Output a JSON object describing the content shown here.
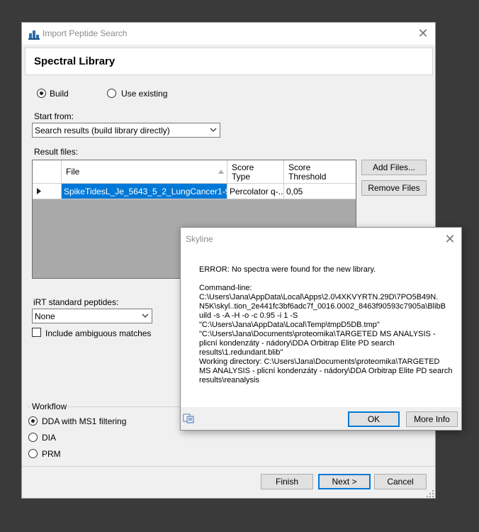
{
  "main_dialog": {
    "title": "Import Peptide Search",
    "header_title": "Spectral Library",
    "build_option": {
      "build_label": "Build",
      "use_existing_label": "Use existing",
      "selected": "Build"
    },
    "start_from": {
      "label": "Start from:",
      "value": "Search results (build library directly)"
    },
    "result_files": {
      "label": "Result files:",
      "columns": {
        "file": "File",
        "score_type_1": "Score",
        "score_type_2": "Type",
        "score_threshold_1": "Score",
        "score_threshold_2": "Threshold"
      },
      "rows": [
        {
          "file": "SpikeTidesL_Je_5643_5_2_LungCancer1-96...",
          "score_type": "Percolator q-...",
          "score_threshold": "0,05"
        }
      ]
    },
    "buttons": {
      "add_files": "Add Files...",
      "remove_files": "Remove Files"
    },
    "irt": {
      "label": "iRT standard peptides:",
      "value": "None",
      "include_ambiguous_label": "Include ambiguous matches"
    },
    "workflow": {
      "label": "Workflow",
      "options": [
        "DDA with MS1 filtering",
        "DIA",
        "PRM"
      ],
      "selected": "DDA with MS1 filtering"
    },
    "footer": {
      "finish": "Finish",
      "next": "Next >",
      "cancel": "Cancel"
    }
  },
  "error_dialog": {
    "title": "Skyline",
    "lines": [
      "ERROR: No spectra were found for the new library.",
      "",
      "Command-line:",
      "C:\\Users\\Jana\\AppData\\Local\\Apps\\2.0\\4XKVYRTN.29D\\7PO5B49N.",
      "N5K\\skyl..tion_2e441fc3bf6adc7f_0016.0002_8463f90593c7905a\\BlibB",
      "uild -s -A -H -o -c 0.95 -i 1 -S",
      "\"C:\\Users\\Jana\\AppData\\Local\\Temp\\tmpD5DB.tmp\"",
      "\"C:\\Users\\Jana\\Documents\\proteomika\\TARGETED MS ANALYSIS -",
      "plicní kondenzáty - nádory\\DDA Orbitrap Elite PD search",
      "results\\1.redundant.blib\"",
      "Working directory: C:\\Users\\Jana\\Documents\\proteomika\\TARGETED",
      "MS ANALYSIS - plicní kondenzáty - nádory\\DDA Orbitrap Elite PD search",
      "results\\reanalysis"
    ],
    "ok": "OK",
    "more_info": "More Info"
  },
  "colors": {
    "selection": "#0078d7",
    "background": "#3a3a3a",
    "dialog": "#f0f0f0"
  }
}
